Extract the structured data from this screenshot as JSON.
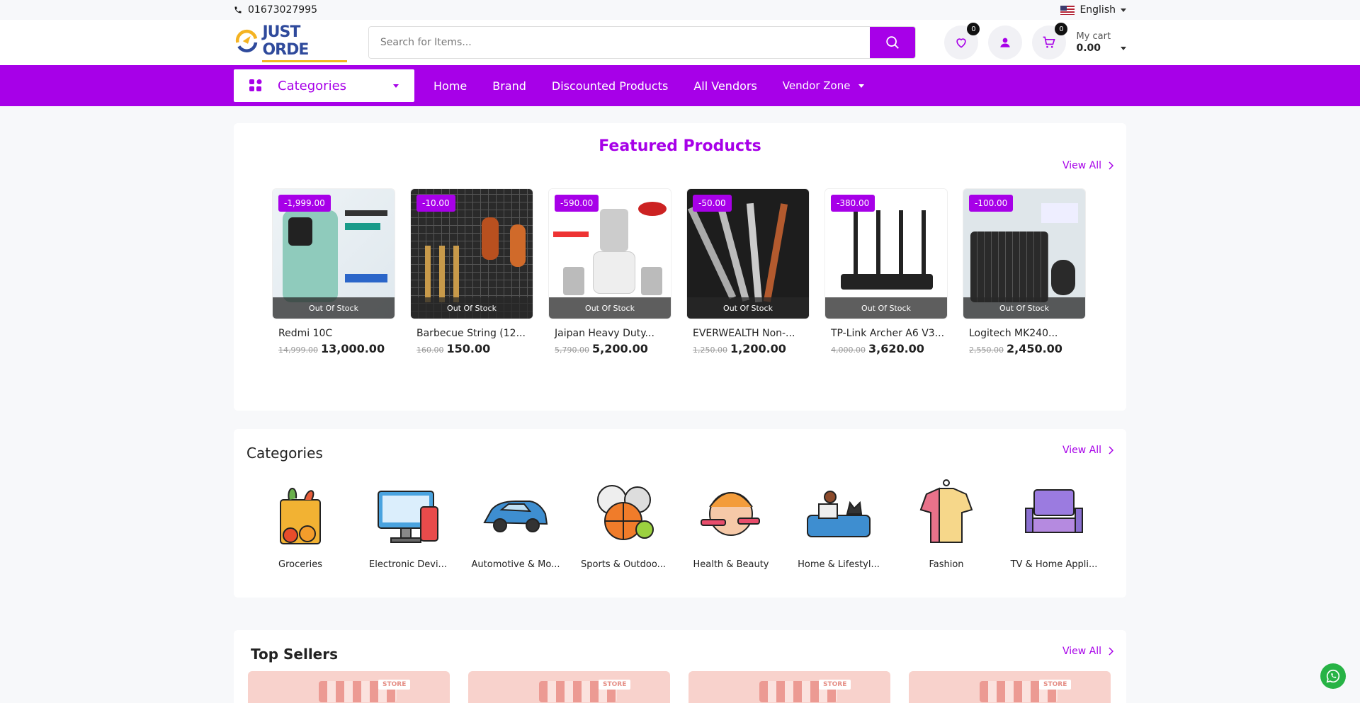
{
  "topbar": {
    "phone": "01673027995",
    "language": "English"
  },
  "header": {
    "logo_text": "JUST ORDE",
    "search_placeholder": "Search for Items...",
    "wishlist_count": "0",
    "cart_count": "0",
    "cart_label": "My cart",
    "cart_total": "0.00"
  },
  "nav": {
    "categories_label": "Categories",
    "links": [
      "Home",
      "Brand",
      "Discounted Products",
      "All Vendors"
    ],
    "vendor_zone": "Vendor Zone"
  },
  "featured": {
    "title": "Featured Products",
    "view_all": "View All",
    "products": [
      {
        "discount": "-1,999.00",
        "stock": "Out Of Stock",
        "name": "Redmi 10C",
        "old_price": "14,999.00",
        "price": "13,000.00",
        "img": "phone"
      },
      {
        "discount": "-10.00",
        "stock": "Out Of Stock",
        "name": "Barbecue String (12...",
        "old_price": "160.00",
        "price": "150.00",
        "img": "bbq"
      },
      {
        "discount": "-590.00",
        "stock": "Out Of Stock",
        "name": "Jaipan Heavy Duty...",
        "old_price": "5,790.00",
        "price": "5,200.00",
        "img": "blender"
      },
      {
        "discount": "-50.00",
        "stock": "Out Of Stock",
        "name": "EVERWEALTH Non-...",
        "old_price": "1,250.00",
        "price": "1,200.00",
        "img": "knives"
      },
      {
        "discount": "-380.00",
        "stock": "Out Of Stock",
        "name": "TP-Link Archer A6 V3...",
        "old_price": "4,000.00",
        "price": "3,620.00",
        "img": "router"
      },
      {
        "discount": "-100.00",
        "stock": "Out Of Stock",
        "name": "Logitech MK240...",
        "old_price": "2,550.00",
        "price": "2,450.00",
        "img": "keyboard"
      }
    ]
  },
  "categories": {
    "title": "Categories",
    "view_all": "View All",
    "items": [
      {
        "name": "Groceries",
        "icon": "groceries-icon"
      },
      {
        "name": "Electronic Devi...",
        "icon": "electronics-icon"
      },
      {
        "name": "Automotive & Mo...",
        "icon": "car-icon"
      },
      {
        "name": "Sports & Outdoo...",
        "icon": "sports-balls-icon"
      },
      {
        "name": "Health & Beauty",
        "icon": "beauty-icon"
      },
      {
        "name": "Home & Lifestyl...",
        "icon": "home-lifestyle-icon"
      },
      {
        "name": "Fashion",
        "icon": "shirt-icon"
      },
      {
        "name": "TV & Home Appli...",
        "icon": "tv-icon"
      }
    ]
  },
  "top_sellers": {
    "title": "Top Sellers",
    "view_all": "View All",
    "store_sign": "STORE"
  },
  "colors": {
    "brand": "#a700e8",
    "whatsapp": "#27b345"
  }
}
